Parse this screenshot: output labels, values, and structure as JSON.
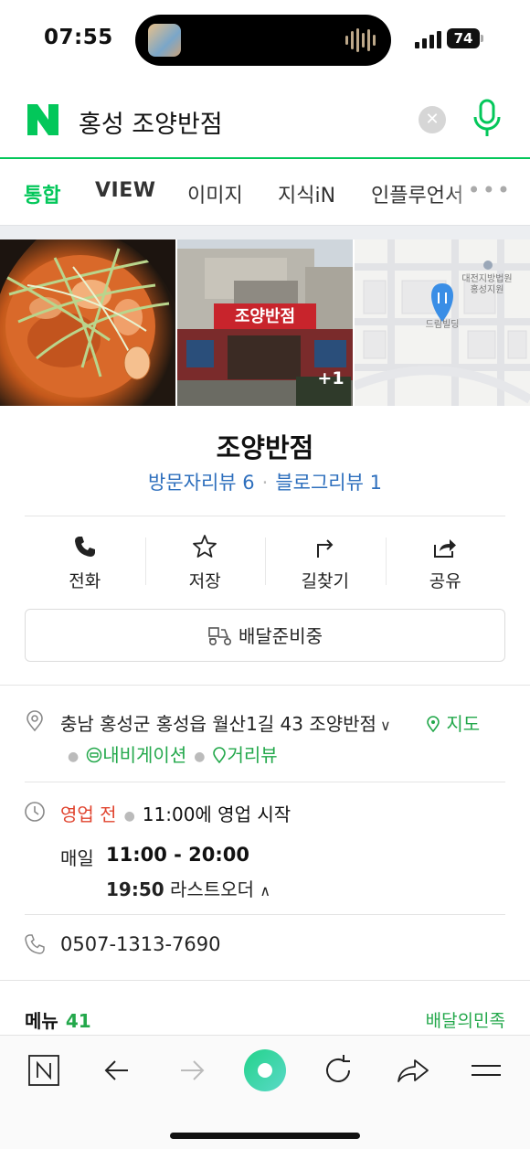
{
  "status_bar": {
    "time": "07:55",
    "battery": "74"
  },
  "search": {
    "query": "홍성 조양반점"
  },
  "tabs": [
    {
      "label": "통합",
      "active": true
    },
    {
      "label": "VIEW",
      "active": false
    },
    {
      "label": "이미지",
      "active": false
    },
    {
      "label": "지식iN",
      "active": false
    },
    {
      "label": "인플루언서",
      "active": false
    }
  ],
  "photos": {
    "store_sign": "조양반점",
    "extra_count": "+1",
    "map_label_1": "대전지방법원",
    "map_label_2": "홍성지원",
    "map_label_3": "드림빌딩"
  },
  "place": {
    "name": "조양반점",
    "visitor_reviews": "방문자리뷰 6",
    "blog_reviews": "블로그리뷰 1"
  },
  "actions": [
    {
      "label": "전화",
      "icon": "phone-icon"
    },
    {
      "label": "저장",
      "icon": "star-icon"
    },
    {
      "label": "길찾기",
      "icon": "directions-icon"
    },
    {
      "label": "공유",
      "icon": "share-icon"
    }
  ],
  "delivery": {
    "label": "배달준비중"
  },
  "info": {
    "address": "충남 홍성군 홍성읍 월산1길 43 조양반점",
    "map_link": "지도",
    "navigation_link": "내비게이션",
    "street_view_link": "거리뷰",
    "status": "영업 전",
    "status_detail": "11:00에 영업 시작",
    "daily_label": "매일",
    "daily_hours": "11:00 - 20:00",
    "last_order_time": "19:50",
    "last_order_label": "라스트오더",
    "phone": "0507-1313-7690"
  },
  "menu": {
    "label": "메뉴",
    "count": "41",
    "provider": "배달의민족"
  },
  "colors": {
    "accent": "#03c75a",
    "link_blue": "#2e6fbd",
    "closed_red": "#e0442f"
  }
}
